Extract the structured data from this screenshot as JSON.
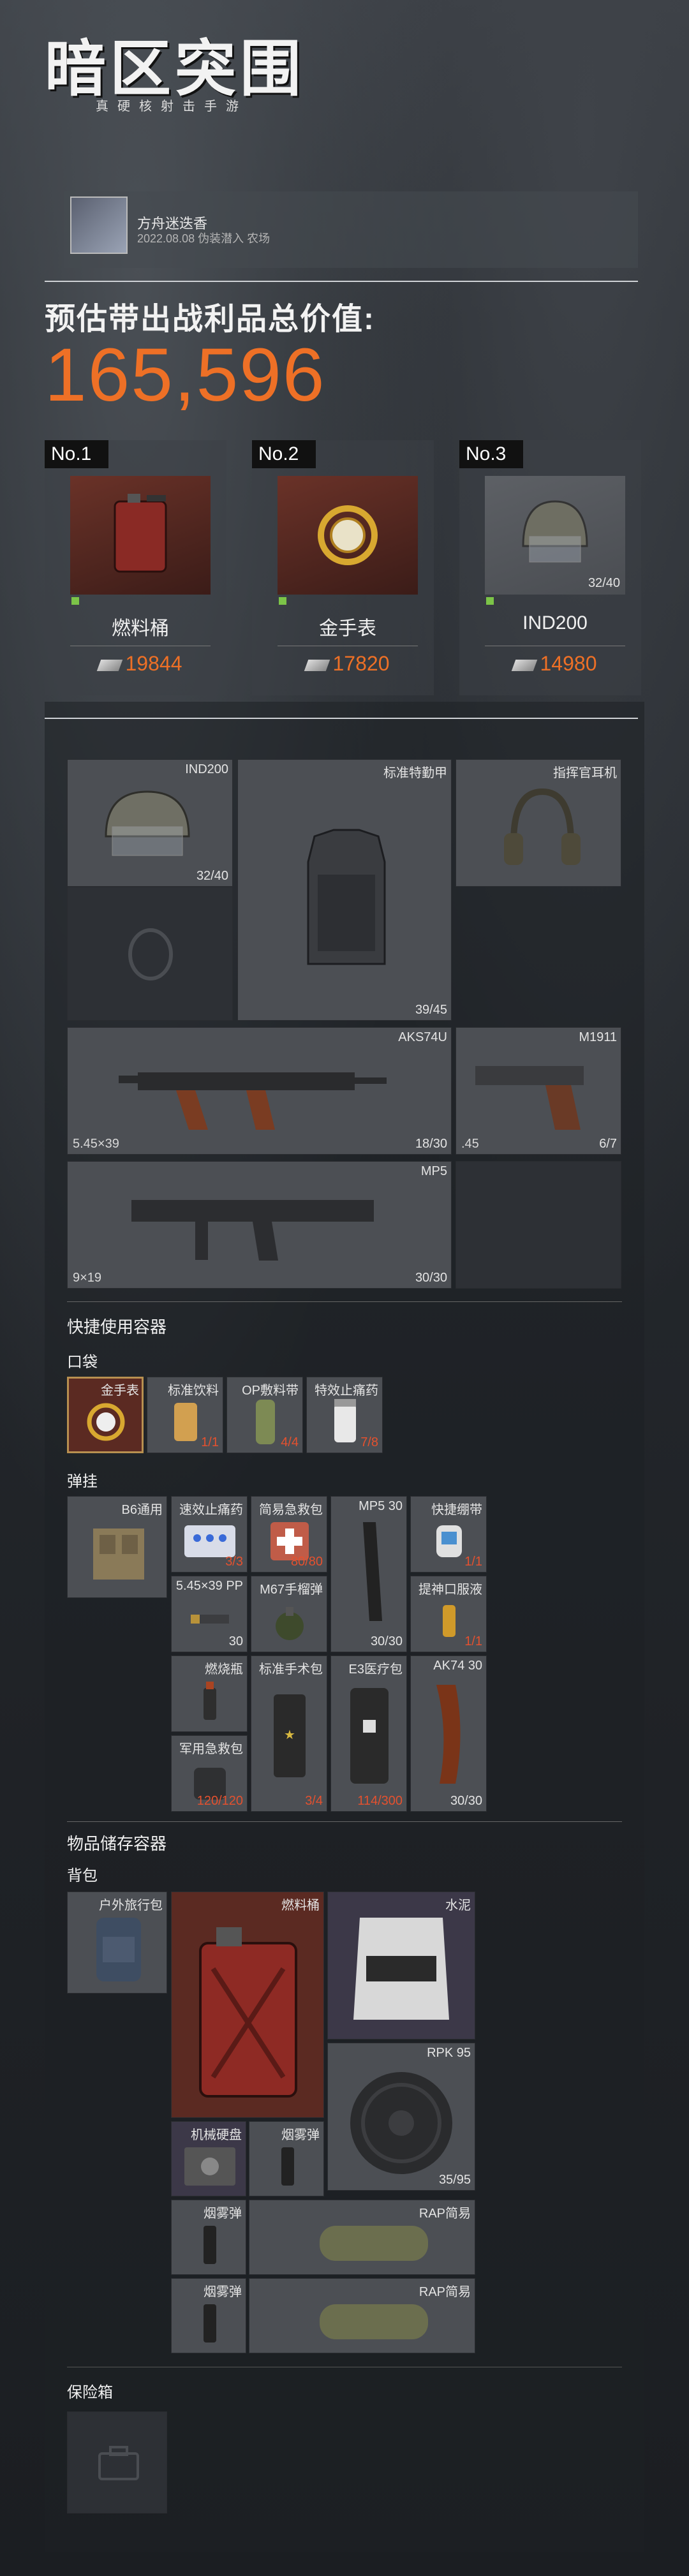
{
  "header": {
    "game_title": "暗区突围",
    "game_subtitle": "真硬核射击手游"
  },
  "user": {
    "name": "方舟迷迭香",
    "date_line": "2022.08.08 伪装潜入 农场"
  },
  "total": {
    "label": "预估带出战利品总价值:",
    "value": "165,596"
  },
  "top_items": [
    {
      "rank": "No.1",
      "name": "燃料桶",
      "price": "19844",
      "count": ""
    },
    {
      "rank": "No.2",
      "name": "金手表",
      "price": "17820",
      "count": ""
    },
    {
      "rank": "No.3",
      "name": "IND200",
      "price": "14980",
      "count": "32/40"
    }
  ],
  "gear": {
    "helmet": {
      "name": "IND200",
      "count": "32/40"
    },
    "armor": {
      "name": "标准特勤甲",
      "count": "39/45"
    },
    "headset": {
      "name": "指挥官耳机"
    },
    "primary": {
      "name": "AKS74U",
      "caliber": "5.45×39",
      "count": "18/30"
    },
    "pistol": {
      "name": "M1911",
      "caliber": ".45",
      "count": "6/7"
    },
    "secondary": {
      "name": "MP5",
      "caliber": "9×19",
      "count": "30/30"
    }
  },
  "quick": {
    "title": "快捷使用容器",
    "pocket_label": "口袋",
    "pockets": [
      {
        "name": "金手表",
        "count": ""
      },
      {
        "name": "标准饮料",
        "count": "1/1"
      },
      {
        "name": "OP敷料带",
        "count": "4/4"
      },
      {
        "name": "特效止痛药",
        "count": "7/8"
      }
    ],
    "rig_label": "弹挂",
    "rig": [
      {
        "name": "B6通用",
        "count": ""
      },
      {
        "name": "速效止痛药",
        "count": "3/3"
      },
      {
        "name": "简易急救包",
        "count": "80/80"
      },
      {
        "name": "MP5 30",
        "count": ""
      },
      {
        "name": "快捷绷带",
        "count": "1/1"
      },
      {
        "name": "5.45×39 PP",
        "count": "30"
      },
      {
        "name": "M67手榴弹",
        "count": ""
      },
      {
        "name": "",
        "count": "30/30"
      },
      {
        "name": "提神口服液",
        "count": "1/1"
      },
      {
        "name": "燃烧瓶",
        "count": ""
      },
      {
        "name": "标准手术包",
        "count": "3/4"
      },
      {
        "name": "E3医疗包",
        "count": "114/300"
      },
      {
        "name": "AK74 30",
        "count": "30/30"
      },
      {
        "name": "军用急救包",
        "count": "120/120"
      }
    ]
  },
  "storage": {
    "title": "物品储存容器",
    "backpack_label": "背包",
    "backpack": [
      {
        "name": "户外旅行包"
      },
      {
        "name": "燃料桶"
      },
      {
        "name": "水泥"
      },
      {
        "name": "RPK 95",
        "count": "35/95"
      },
      {
        "name": "机械硬盘"
      },
      {
        "name": "烟雾弹"
      },
      {
        "name": "烟雾弹"
      },
      {
        "name": "RAP简易"
      },
      {
        "name": "烟雾弹"
      },
      {
        "name": "RAP简易"
      }
    ],
    "safe_label": "保险箱"
  },
  "colors": {
    "accent": "#ee7026",
    "count_red": "#e4512f",
    "rarity_green": "#7cc448"
  }
}
